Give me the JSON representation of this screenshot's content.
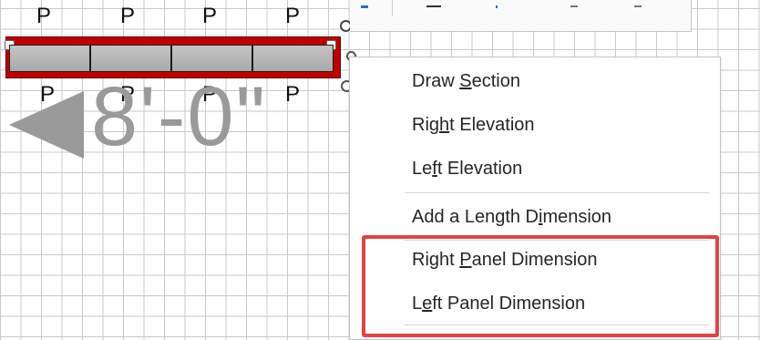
{
  "panel_labels_top": [
    "P",
    "P",
    "P",
    "P"
  ],
  "panel_labels_bottom": [
    "P",
    "P",
    "P",
    "P"
  ],
  "dimension": {
    "text": "8'-0\""
  },
  "context_menu": {
    "items": [
      {
        "label": "Draw Section",
        "access_key": "S"
      },
      {
        "label": "Right Elevation",
        "access_key": "h"
      },
      {
        "label": "Left Elevation",
        "access_key": "f"
      },
      {
        "label": "Add a Length Dimension",
        "access_key": "i"
      },
      {
        "label": "Right Panel Dimension",
        "access_key": "P"
      },
      {
        "label": "Left Panel Dimension",
        "access_key": "e"
      }
    ]
  },
  "colors": {
    "wall_red": "#c00000",
    "highlight": "#e04444",
    "dimension_gray": "#9a9a9a",
    "grid": "#c9c9c9"
  }
}
